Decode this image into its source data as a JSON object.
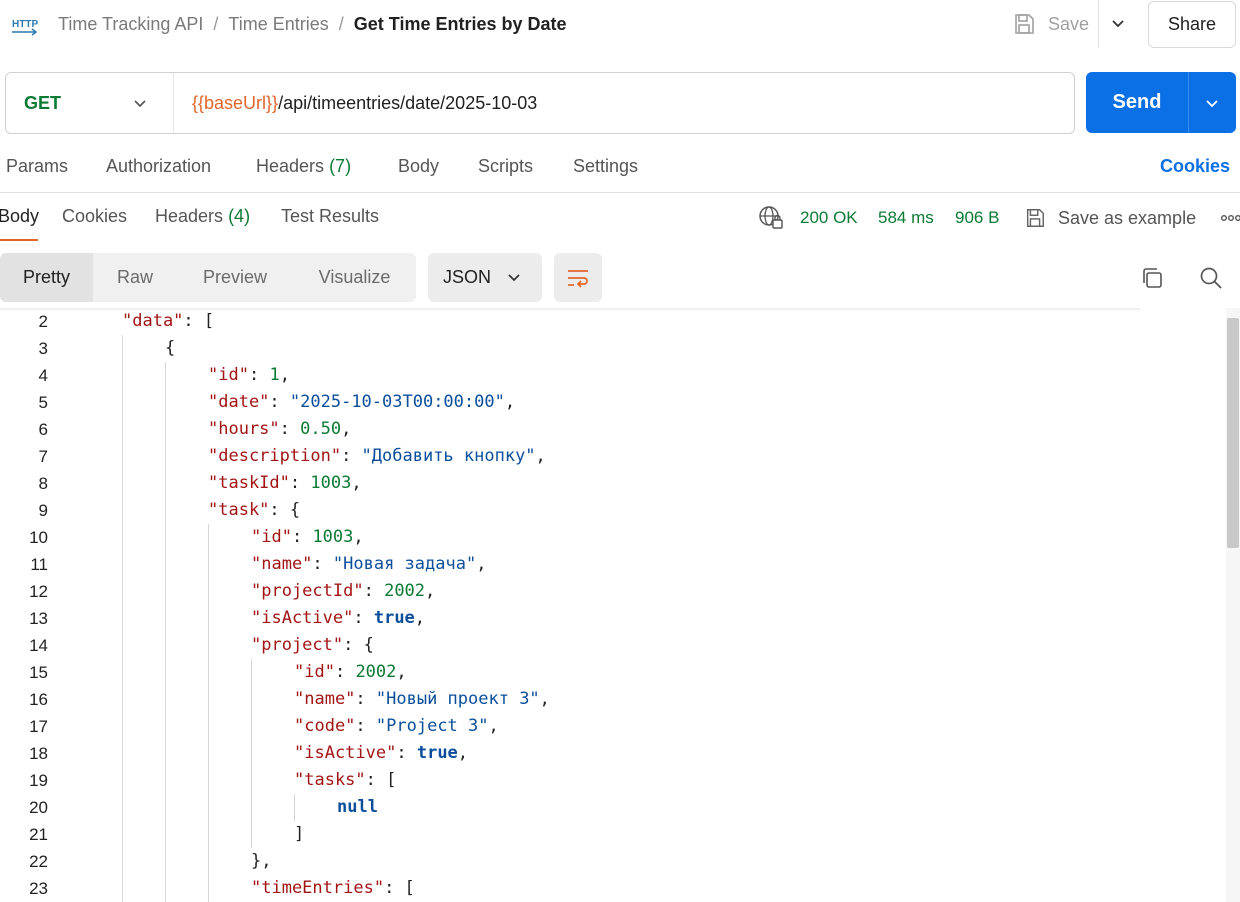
{
  "header": {
    "breadcrumb": [
      "Time Tracking API",
      "Time Entries"
    ],
    "title": "Get Time Entries by Date",
    "save_label": "Save",
    "share_label": "Share",
    "separator": "/"
  },
  "request": {
    "method": "GET",
    "url_variable": "{{baseUrl}}",
    "url_path": "/api/timeentries/date/2025-10-03",
    "send_label": "Send"
  },
  "request_tabs": [
    {
      "label": "Params",
      "count": ""
    },
    {
      "label": "Authorization",
      "count": ""
    },
    {
      "label": "Headers",
      "count": "(7)"
    },
    {
      "label": "Body",
      "count": ""
    },
    {
      "label": "Scripts",
      "count": ""
    },
    {
      "label": "Settings",
      "count": ""
    }
  ],
  "cookies_link": "Cookies",
  "response_tabs": [
    {
      "label": "Body",
      "count": ""
    },
    {
      "label": "Cookies",
      "count": ""
    },
    {
      "label": "Headers",
      "count": "(4)"
    },
    {
      "label": "Test Results",
      "count": ""
    }
  ],
  "response_status": {
    "status": "200 OK",
    "time": "584 ms",
    "size": "906 B",
    "save_example": "Save as example"
  },
  "view_modes": [
    "Pretty",
    "Raw",
    "Preview",
    "Visualize"
  ],
  "format": "JSON",
  "code_lines": [
    {
      "n": "2",
      "depth": 1,
      "tokens": [
        [
          "k",
          "\"data\""
        ],
        [
          "p",
          ": ["
        ]
      ]
    },
    {
      "n": "3",
      "depth": 2,
      "tokens": [
        [
          "p",
          "{"
        ]
      ]
    },
    {
      "n": "4",
      "depth": 3,
      "tokens": [
        [
          "k",
          "\"id\""
        ],
        [
          "p",
          ": "
        ],
        [
          "n",
          "1"
        ],
        [
          "p",
          ","
        ]
      ]
    },
    {
      "n": "5",
      "depth": 3,
      "tokens": [
        [
          "k",
          "\"date\""
        ],
        [
          "p",
          ": "
        ],
        [
          "s",
          "\"2025-10-03T00:00:00\""
        ],
        [
          "p",
          ","
        ]
      ]
    },
    {
      "n": "6",
      "depth": 3,
      "tokens": [
        [
          "k",
          "\"hours\""
        ],
        [
          "p",
          ": "
        ],
        [
          "n",
          "0.50"
        ],
        [
          "p",
          ","
        ]
      ]
    },
    {
      "n": "7",
      "depth": 3,
      "tokens": [
        [
          "k",
          "\"description\""
        ],
        [
          "p",
          ": "
        ],
        [
          "s",
          "\"Добавить кнопку\""
        ],
        [
          "p",
          ","
        ]
      ]
    },
    {
      "n": "8",
      "depth": 3,
      "tokens": [
        [
          "k",
          "\"taskId\""
        ],
        [
          "p",
          ": "
        ],
        [
          "n",
          "1003"
        ],
        [
          "p",
          ","
        ]
      ]
    },
    {
      "n": "9",
      "depth": 3,
      "tokens": [
        [
          "k",
          "\"task\""
        ],
        [
          "p",
          ": {"
        ]
      ]
    },
    {
      "n": "10",
      "depth": 4,
      "tokens": [
        [
          "k",
          "\"id\""
        ],
        [
          "p",
          ": "
        ],
        [
          "n",
          "1003"
        ],
        [
          "p",
          ","
        ]
      ]
    },
    {
      "n": "11",
      "depth": 4,
      "tokens": [
        [
          "k",
          "\"name\""
        ],
        [
          "p",
          ": "
        ],
        [
          "s",
          "\"Новая задача\""
        ],
        [
          "p",
          ","
        ]
      ]
    },
    {
      "n": "12",
      "depth": 4,
      "tokens": [
        [
          "k",
          "\"projectId\""
        ],
        [
          "p",
          ": "
        ],
        [
          "n",
          "2002"
        ],
        [
          "p",
          ","
        ]
      ]
    },
    {
      "n": "13",
      "depth": 4,
      "tokens": [
        [
          "k",
          "\"isActive\""
        ],
        [
          "p",
          ": "
        ],
        [
          "b",
          "true"
        ],
        [
          "p",
          ","
        ]
      ]
    },
    {
      "n": "14",
      "depth": 4,
      "tokens": [
        [
          "k",
          "\"project\""
        ],
        [
          "p",
          ": {"
        ]
      ]
    },
    {
      "n": "15",
      "depth": 5,
      "tokens": [
        [
          "k",
          "\"id\""
        ],
        [
          "p",
          ": "
        ],
        [
          "n",
          "2002"
        ],
        [
          "p",
          ","
        ]
      ]
    },
    {
      "n": "16",
      "depth": 5,
      "tokens": [
        [
          "k",
          "\"name\""
        ],
        [
          "p",
          ": "
        ],
        [
          "s",
          "\"Новый проект 3\""
        ],
        [
          "p",
          ","
        ]
      ]
    },
    {
      "n": "17",
      "depth": 5,
      "tokens": [
        [
          "k",
          "\"code\""
        ],
        [
          "p",
          ": "
        ],
        [
          "s",
          "\"Project 3\""
        ],
        [
          "p",
          ","
        ]
      ]
    },
    {
      "n": "18",
      "depth": 5,
      "tokens": [
        [
          "k",
          "\"isActive\""
        ],
        [
          "p",
          ": "
        ],
        [
          "b",
          "true"
        ],
        [
          "p",
          ","
        ]
      ]
    },
    {
      "n": "19",
      "depth": 5,
      "tokens": [
        [
          "k",
          "\"tasks\""
        ],
        [
          "p",
          ": ["
        ]
      ]
    },
    {
      "n": "20",
      "depth": 6,
      "tokens": [
        [
          "b",
          "null"
        ]
      ]
    },
    {
      "n": "21",
      "depth": 5,
      "tokens": [
        [
          "p",
          "]"
        ]
      ]
    },
    {
      "n": "22",
      "depth": 4,
      "tokens": [
        [
          "p",
          "},"
        ]
      ]
    },
    {
      "n": "23",
      "depth": 4,
      "tokens": [
        [
          "k",
          "\"timeEntries\""
        ],
        [
          "p",
          ": ["
        ]
      ]
    }
  ],
  "colors": {
    "accent": "#e2662a",
    "send": "#0b6fe6",
    "method": "#0b7a34",
    "json_key": "#a31515",
    "json_string": "#0b4f9c",
    "json_number": "#0b7a34"
  },
  "icons": [
    "http-icon",
    "save-icon",
    "chevron-down-icon",
    "globe-icon",
    "save-example-icon",
    "more-icon",
    "wrap-lines-icon",
    "copy-icon",
    "search-icon"
  ]
}
